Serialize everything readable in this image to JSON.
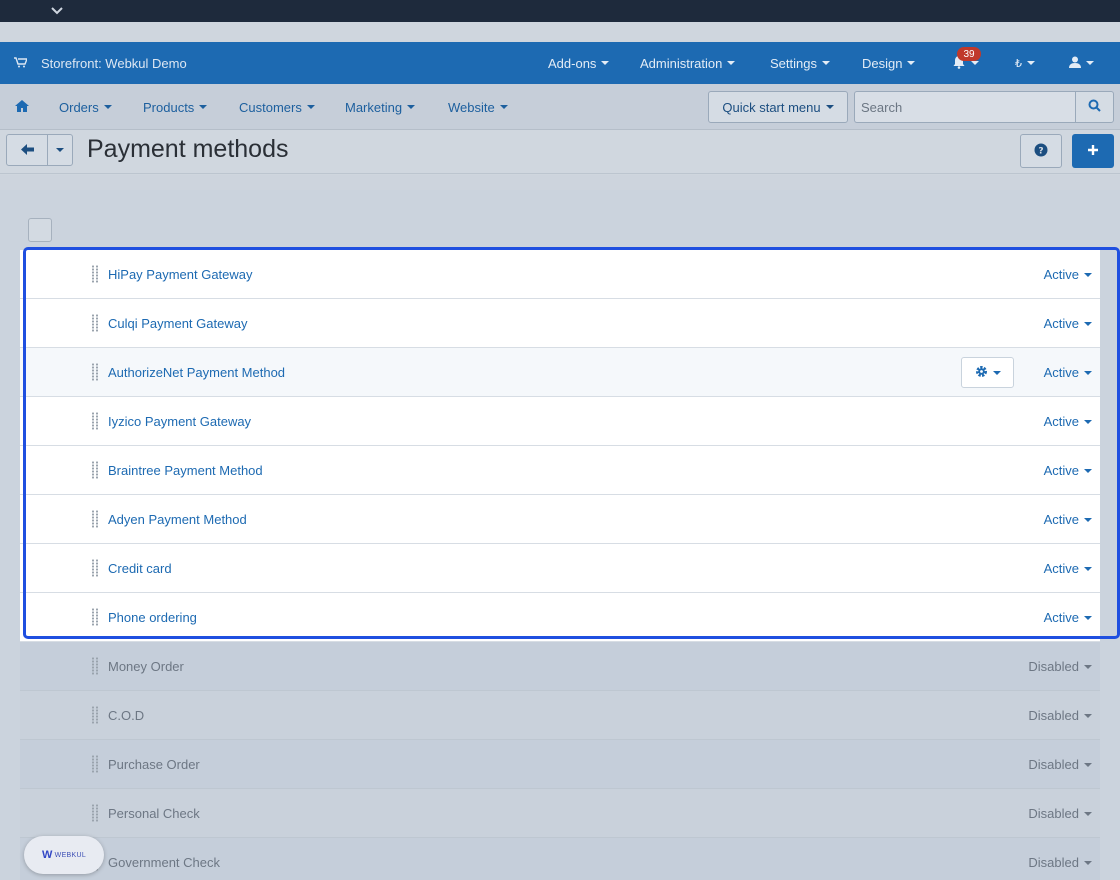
{
  "topnav": {
    "store_label": "Storefront: Webkul Demo",
    "menus": [
      "Add-ons",
      "Administration",
      "Settings",
      "Design"
    ],
    "notification_count": "39",
    "currency_symbol": "₺"
  },
  "subnav": {
    "menus": [
      "Orders",
      "Products",
      "Customers",
      "Marketing",
      "Website"
    ],
    "quick_start_label": "Quick start menu",
    "search_placeholder": "Search"
  },
  "page": {
    "title": "Payment methods"
  },
  "payment_methods": [
    {
      "name": "HiPay Payment Gateway",
      "status": "Active"
    },
    {
      "name": "Culqi Payment Gateway",
      "status": "Active"
    },
    {
      "name": "AuthorizeNet Payment Method",
      "status": "Active"
    },
    {
      "name": "Iyzico Payment Gateway",
      "status": "Active"
    },
    {
      "name": "Braintree Payment Method",
      "status": "Active"
    },
    {
      "name": "Adyen Payment Method",
      "status": "Active"
    },
    {
      "name": "Credit card",
      "status": "Active"
    },
    {
      "name": "Phone ordering",
      "status": "Active"
    },
    {
      "name": "Money Order",
      "status": "Disabled"
    },
    {
      "name": "C.O.D",
      "status": "Disabled"
    },
    {
      "name": "Purchase Order",
      "status": "Disabled"
    },
    {
      "name": "Personal Check",
      "status": "Disabled"
    },
    {
      "name": "Government Check",
      "status": "Disabled"
    }
  ],
  "webkul_badge": {
    "text": "WEBKUL"
  },
  "colors": {
    "brand_blue": "#1d6ab2",
    "highlight": "#1f4fe0",
    "badge_red": "#c0392b"
  }
}
